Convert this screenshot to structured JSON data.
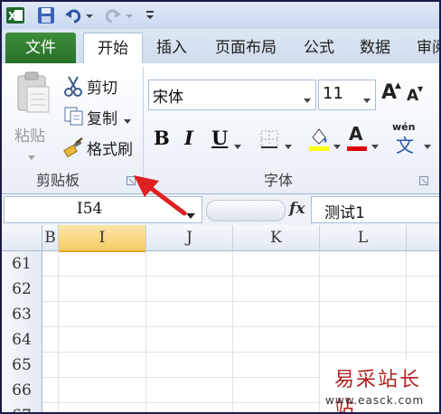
{
  "tabs": [
    {
      "label": "文件"
    },
    {
      "label": "开始"
    },
    {
      "label": "插入"
    },
    {
      "label": "页面布局"
    },
    {
      "label": "公式"
    },
    {
      "label": "数据"
    },
    {
      "label": "审阅"
    }
  ],
  "clipboard": {
    "paste_label": "粘贴",
    "cut_label": "剪切",
    "copy_label": "复制",
    "format_painter_label": "格式刷",
    "group_label": "剪贴板"
  },
  "font": {
    "font_name": "宋体",
    "font_size": "11",
    "bold_label": "B",
    "italic_label": "I",
    "underline_label": "U",
    "grow_label": "A",
    "shrink_label": "A",
    "color_label": "A",
    "wen_top": "wén",
    "wen_char": "文",
    "group_label": "字体"
  },
  "formula_bar": {
    "name_box": "I54",
    "fx_label": "fx",
    "formula_value": "测试1"
  },
  "grid": {
    "columns": [
      "B",
      "I",
      "J",
      "K",
      "L"
    ],
    "rows": [
      "61",
      "62",
      "63",
      "64",
      "65",
      "66",
      "67"
    ]
  },
  "watermark": {
    "title": "易采站长站",
    "url": "www.easck.com"
  },
  "colors": {
    "file_tab": "#2e7d32",
    "annotation_arrow": "#e02020",
    "selected_col_header": "#f7d36b"
  }
}
